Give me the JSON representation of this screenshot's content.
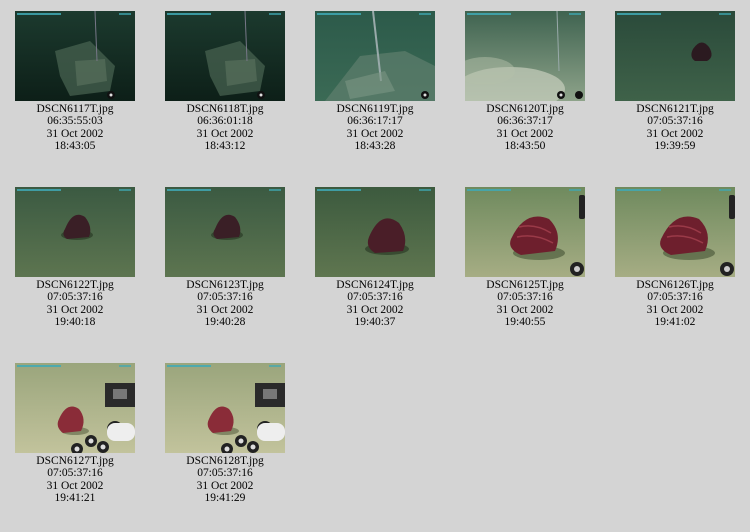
{
  "gallery": {
    "items": [
      {
        "filename": "DSCN6117T.jpg",
        "timecode": "06:35:55:03",
        "date": "31 Oct 2002",
        "time": "18:43:05",
        "scene": "dark-debris"
      },
      {
        "filename": "DSCN6118T.jpg",
        "timecode": "06:36:01:18",
        "date": "31 Oct 2002",
        "time": "18:43:12",
        "scene": "dark-debris"
      },
      {
        "filename": "DSCN6119T.jpg",
        "timecode": "06:36:17:17",
        "date": "31 Oct 2002",
        "time": "18:43:28",
        "scene": "debris-pole"
      },
      {
        "filename": "DSCN6120T.jpg",
        "timecode": "06:36:37:17",
        "date": "31 Oct 2002",
        "time": "18:43:50",
        "scene": "silt-cloud"
      },
      {
        "filename": "DSCN6121T.jpg",
        "timecode": "07:05:37:16",
        "date": "31 Oct 2002",
        "time": "19:39:59",
        "scene": "small-creature"
      },
      {
        "filename": "DSCN6122T.jpg",
        "timecode": "07:05:37:16",
        "date": "31 Oct 2002",
        "time": "19:40:18",
        "scene": "creature"
      },
      {
        "filename": "DSCN6123T.jpg",
        "timecode": "07:05:37:16",
        "date": "31 Oct 2002",
        "time": "19:40:28",
        "scene": "creature"
      },
      {
        "filename": "DSCN6124T.jpg",
        "timecode": "07:05:37:16",
        "date": "31 Oct 2002",
        "time": "19:40:37",
        "scene": "creature-large"
      },
      {
        "filename": "DSCN6125T.jpg",
        "timecode": "07:05:37:16",
        "date": "31 Oct 2002",
        "time": "19:40:55",
        "scene": "creature-bright"
      },
      {
        "filename": "DSCN6126T.jpg",
        "timecode": "07:05:37:16",
        "date": "31 Oct 2002",
        "time": "19:41:02",
        "scene": "creature-bright"
      },
      {
        "filename": "DSCN6127T.jpg",
        "timecode": "07:05:37:16",
        "date": "31 Oct 2002",
        "time": "19:41:21",
        "scene": "creature-equipment"
      },
      {
        "filename": "DSCN6128T.jpg",
        "timecode": "07:05:37:16",
        "date": "31 Oct 2002",
        "time": "19:41:29",
        "scene": "creature-equipment"
      }
    ]
  },
  "colors": {
    "background": "#d4d4d4",
    "seafloor_dark": "#1f3a2c",
    "seafloor_mid": "#3d5e3f",
    "seafloor_light": "#8a9a6a",
    "creature": "#6a1f2a",
    "overlay_text": "#3fa9b5"
  }
}
